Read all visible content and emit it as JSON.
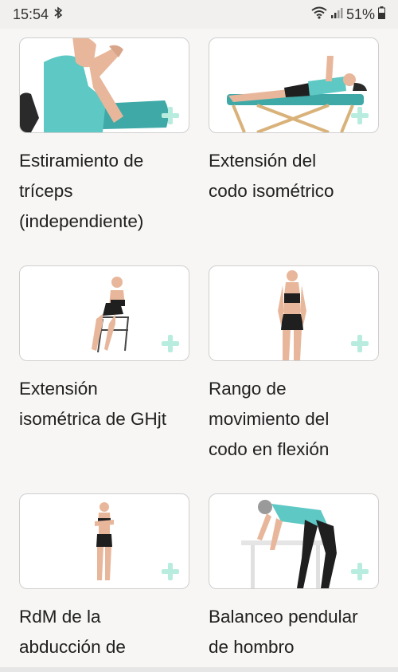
{
  "status_bar": {
    "time": "15:54",
    "battery": "51%",
    "icons": [
      "bluetooth-icon",
      "wifi-icon",
      "signal-icon",
      "battery-icon"
    ]
  },
  "colors": {
    "plus_accent": "#b8ecdf",
    "shirt_teal": "#5ec8c4"
  },
  "exercises": [
    {
      "title_lines": [
        "Estiramiento de",
        "tríceps",
        "(independiente)"
      ],
      "icon": "add-icon"
    },
    {
      "title_lines": [
        "Extensión del",
        "codo isométrico"
      ],
      "icon": "add-icon"
    },
    {
      "title_lines": [
        "Extensión",
        "isométrica de GHjt"
      ],
      "icon": "add-icon"
    },
    {
      "title_lines": [
        "Rango de",
        "movimiento del",
        "codo en flexión"
      ],
      "icon": "add-icon"
    },
    {
      "title_lines": [
        "RdM de la",
        "abducción de"
      ],
      "icon": "add-icon"
    },
    {
      "title_lines": [
        "Balanceo pendular",
        "de hombro"
      ],
      "icon": "add-icon"
    }
  ]
}
